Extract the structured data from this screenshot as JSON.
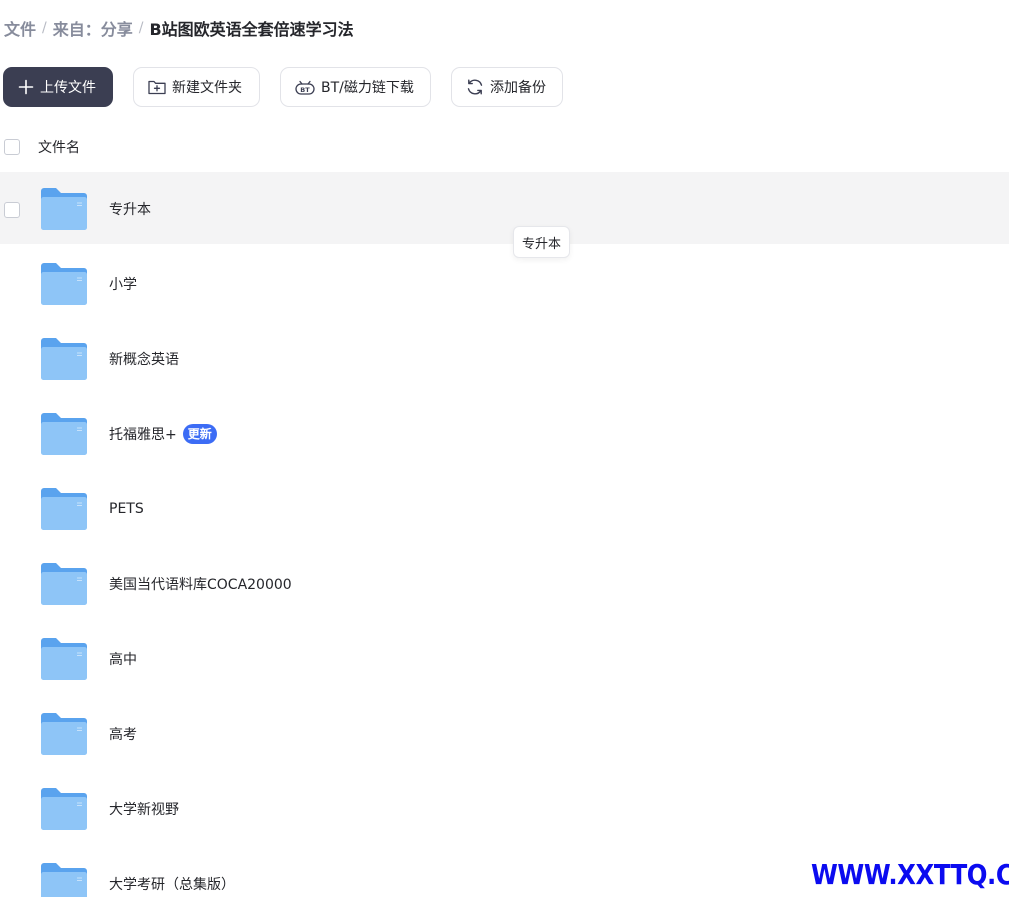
{
  "breadcrumb": {
    "root": "文件",
    "source": "来自：分享",
    "current": "B站图欧英语全套倍速学习法",
    "separator": "/"
  },
  "toolbar": {
    "upload_label": "上传文件",
    "new_folder_label": "新建文件夹",
    "bt_label": "BT/磁力链下载",
    "backup_label": "添加备份"
  },
  "table": {
    "column_name": "文件名"
  },
  "files": [
    {
      "name": "专升本",
      "badge": ""
    },
    {
      "name": "小学",
      "badge": ""
    },
    {
      "name": "新概念英语",
      "badge": ""
    },
    {
      "name": "托福雅思+",
      "badge": "更新"
    },
    {
      "name": "PETS",
      "badge": ""
    },
    {
      "name": "美国当代语料库COCA20000",
      "badge": ""
    },
    {
      "name": "高中",
      "badge": ""
    },
    {
      "name": "高考",
      "badge": ""
    },
    {
      "name": "大学新视野",
      "badge": ""
    },
    {
      "name": "大学考研（总集版）",
      "badge": ""
    }
  ],
  "tooltip": "专升本",
  "watermark": "WWW.XXTTQ.COM",
  "colors": {
    "primary_button": "#3b3e52",
    "badge": "#3c6cf5",
    "folder": "#8ec5f7",
    "hover_row": "#f4f4f5",
    "watermark": "#0b0bf0"
  },
  "icons": {
    "upload": "plus-icon",
    "new_folder": "folder-plus-icon",
    "bt": "bt-icon",
    "backup": "refresh-icon",
    "folder": "folder-icon"
  }
}
